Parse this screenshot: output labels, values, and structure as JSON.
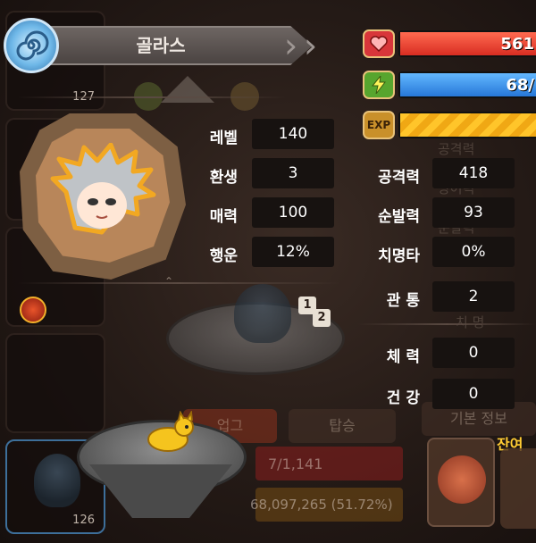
{
  "title": {
    "name": "골라스"
  },
  "bars": {
    "hp": {
      "value": "561",
      "icon": "heart-icon",
      "color": "#e8443a",
      "fill": 1.0
    },
    "mp": {
      "value": "68/",
      "icon": "lightning-icon",
      "color": "#3a96e8",
      "fill": 1.0
    },
    "exp": {
      "label": "EXP",
      "icon": "exp-icon",
      "color": "#f4b21c",
      "fill": 1.0
    }
  },
  "left_stats": [
    {
      "label": "레벨",
      "value": "140"
    },
    {
      "label": "환생",
      "value": "3"
    },
    {
      "label": "매력",
      "value": "100"
    },
    {
      "label": "행운",
      "value": "12%"
    }
  ],
  "right_stats": [
    {
      "label": "공격력",
      "value": "418"
    },
    {
      "label": "순발력",
      "value": "93"
    },
    {
      "label": "치명타",
      "value": "0%"
    },
    {
      "label": "관 통",
      "value": "2"
    },
    {
      "label": "체 력",
      "value": "0"
    },
    {
      "label": "건 강",
      "value": "0"
    }
  ],
  "page_badge": {
    "current": "1",
    "total": "2"
  },
  "sidebar": {
    "slot_counts": [
      "127",
      "126"
    ]
  },
  "background": {
    "tab_left": "업그",
    "tab_mid": "탑승",
    "tab_right": "기본 정보",
    "remaining_label": "잔여",
    "gold_text": "68,097,265 (51.72%)",
    "hp_text": "7/1,141"
  },
  "colors": {
    "frame_gold": "#e8c27a",
    "panel": "#171210"
  }
}
